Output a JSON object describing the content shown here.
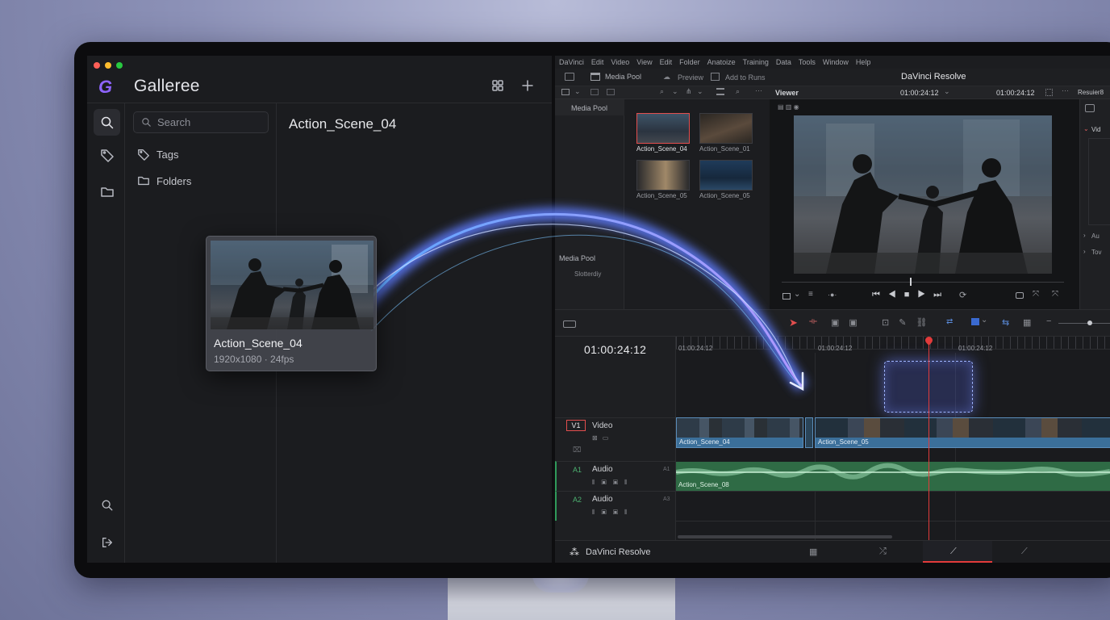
{
  "galleree": {
    "app_name": "Galleree",
    "search_placeholder": "Search",
    "sidebar_items": [
      {
        "label": "Tags"
      },
      {
        "label": "Folders"
      }
    ],
    "main_title": "Action_Scene_04",
    "dragged_card": {
      "name": "Action_Scene_04",
      "meta": "1920x1080 · 24fps"
    }
  },
  "resolve": {
    "menu": [
      "DaVinci",
      "Edit",
      "Video",
      "View",
      "Edit",
      "Folder",
      "Anatoize",
      "Training",
      "Data",
      "Tools",
      "Window",
      "Help"
    ],
    "toolbar": {
      "media_pool": "Media Pool",
      "preview": "Preview",
      "add_to": "Add to Runs",
      "app_title": "DaVinci Resolve"
    },
    "toolbar2": {
      "viewer": "Viewer",
      "timecode1": "01:00:24:12",
      "timecode2": "01:00:24:12",
      "inspector": "Resuier8"
    },
    "pool_side": {
      "header": "Media Pool",
      "section": "Media Pool",
      "sub": "Slotterdiy"
    },
    "clips": [
      {
        "name": "Action_Scene_04"
      },
      {
        "name": "Action_Scene_01"
      },
      {
        "name": "Action_Scene_05"
      },
      {
        "name": "Action_Scene_05"
      }
    ],
    "inspector_items": [
      "Vid",
      "Au",
      "Tov"
    ],
    "timeline": {
      "timecode": "01:00:24:12",
      "ruler": [
        "01:00:24:12",
        "01:00:24:12",
        "01:00:24:12"
      ],
      "tracks": [
        {
          "id": "V1",
          "name": "Video"
        },
        {
          "id": "A1",
          "name": "Audio",
          "ch": "A1"
        },
        {
          "id": "A2",
          "name": "Audio",
          "ch": "A3"
        }
      ],
      "video_clips": [
        "Action_Scene_04",
        "Action_Scene_05"
      ],
      "audio_clip": "Action_Scene_08"
    },
    "footer": {
      "brand": "DaVinci Resolve"
    }
  },
  "colors": {
    "accent": "#8e64ff",
    "playhead": "#e23b3b",
    "video_clip": "#3b6f9a",
    "audio_clip": "#2f6b45",
    "beam": "#6f8cff"
  }
}
